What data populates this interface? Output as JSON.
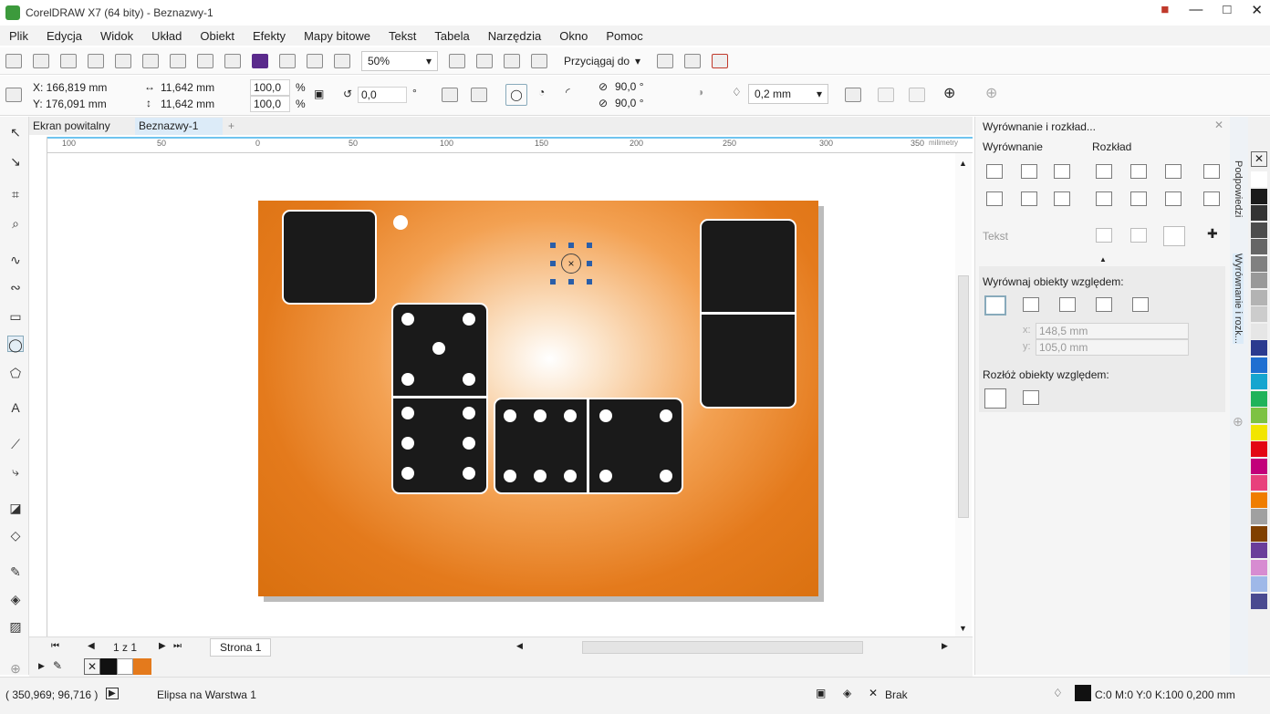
{
  "title": "CorelDRAW X7 (64 bity) - Beznazwy-1",
  "menu": [
    "Plik",
    "Edycja",
    "Widok",
    "Układ",
    "Obiekt",
    "Efekty",
    "Mapy bitowe",
    "Tekst",
    "Tabela",
    "Narzędzia",
    "Okno",
    "Pomoc"
  ],
  "toolbar": {
    "zoom": "50%",
    "snap": "Przyciągaj do"
  },
  "props": {
    "x": "X: 166,819 mm",
    "y": "Y: 176,091 mm",
    "w": "11,642 mm",
    "h": "11,642 mm",
    "sx": "100,0",
    "sy": "100,0",
    "pct1": "%",
    "pct2": "%",
    "rot": "0,0",
    "deg": "°",
    "ang1": "90,0 °",
    "ang2": "90,0 °",
    "outline": "0,2 mm"
  },
  "tabs": {
    "welcome": "Ekran powitalny",
    "doc": "Beznazwy-1"
  },
  "ruler_labels": [
    "100",
    "50",
    "0",
    "50",
    "100",
    "150",
    "200",
    "250",
    "300",
    "350"
  ],
  "ruler_unit": "milimetry",
  "pages": {
    "counter": "1 z 1",
    "page": "Strona 1"
  },
  "docker": {
    "title": "Wyrównanie i rozkład...",
    "align": "Wyrównanie",
    "distribute": "Rozkład",
    "text": "Tekst",
    "align_to": "Wyrównaj obiekty względem:",
    "xval": "148,5 mm",
    "yval": "105,0 mm",
    "xlab": "x:",
    "ylab": "y:",
    "distribute_to": "Rozłóż obiekty względem:"
  },
  "side_tabs": {
    "hints": "Podpowiedzi",
    "align": "Wyrównanie i rozk..."
  },
  "status": {
    "coords": "( 350,969; 96,716 )",
    "object": "Elipsa na Warstwa 1",
    "fill": "Brak",
    "outline": "C:0 M:0 Y:0 K:100  0,200 mm"
  },
  "colors": {
    "accent": "#e47a1c",
    "palette": [
      "#ffffff",
      "#1a1a1a",
      "#333333",
      "#4d4d4d",
      "#666666",
      "#808080",
      "#999999",
      "#b3b3b3",
      "#cccccc",
      "#e6e6e6",
      "#2b3a8f",
      "#1f6fd1",
      "#16a5cf",
      "#1fb35a",
      "#7dc242",
      "#f2e500",
      "#e30613",
      "#c2007a",
      "#e8417c",
      "#ef7d00",
      "#a0a0a0",
      "#804000",
      "#6a3d9a",
      "#d78cd1",
      "#9fb8e8",
      "#4a4a90"
    ]
  }
}
